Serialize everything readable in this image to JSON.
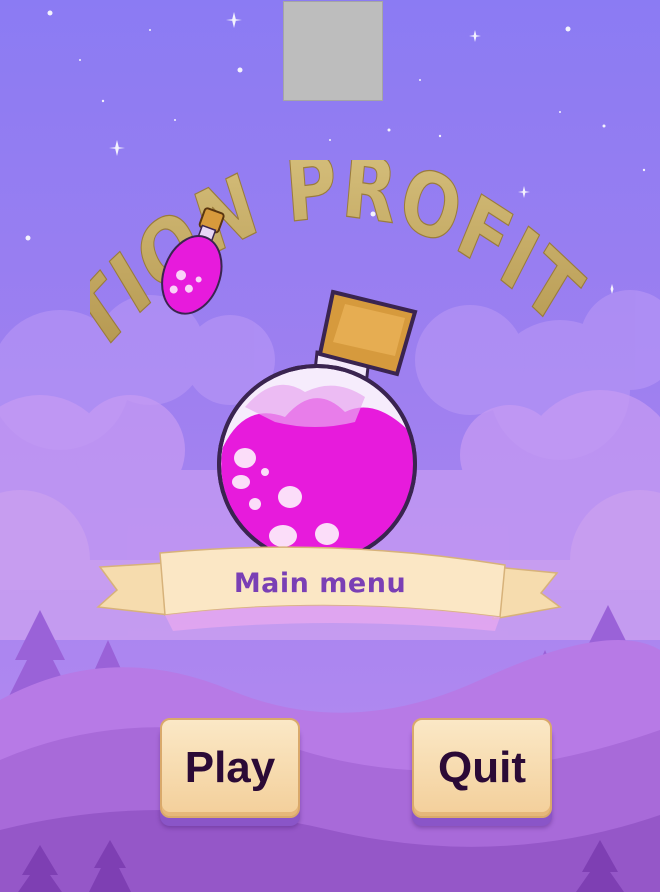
{
  "game": {
    "title": "POTION PROFITEER",
    "ribbon_label": "Main menu"
  },
  "buttons": {
    "play_label": "Play",
    "quit_label": "Quit"
  },
  "colors": {
    "sky_top": "#8f7cf2",
    "sky_bottom": "#b58df0",
    "potion_liquid": "#e71bdc",
    "title_gold": "#c9b06a",
    "button_text": "#2b0a36",
    "ribbon_text": "#7a3fb5"
  },
  "icons": [
    "star-icon",
    "potion-bottle-icon",
    "pine-tree-icon",
    "cloud-icon"
  ]
}
